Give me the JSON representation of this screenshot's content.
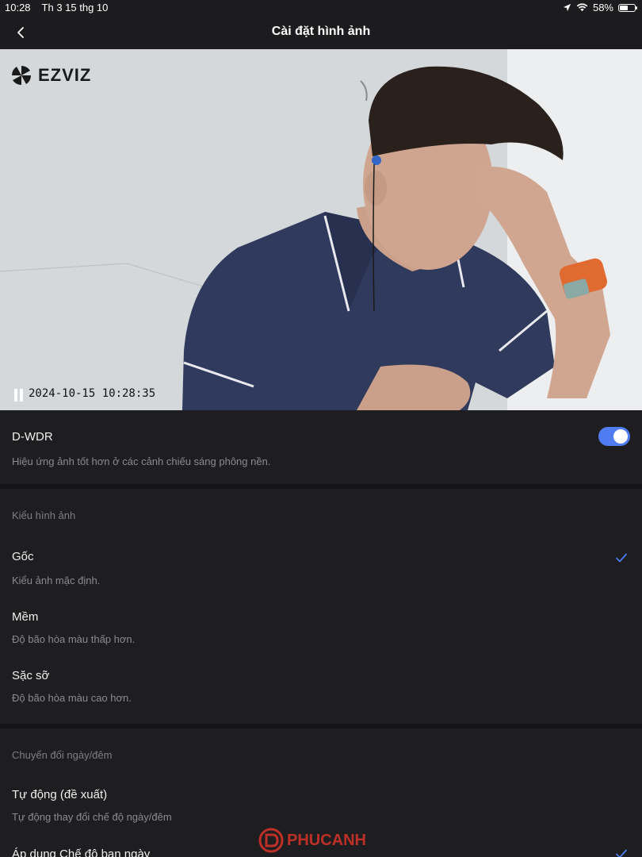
{
  "status_bar": {
    "time": "10:28",
    "date": "Th 3 15 thg 10",
    "battery": "58%",
    "battery_level": 0.58
  },
  "nav": {
    "title": "Cài đặt hình ảnh"
  },
  "video": {
    "brand": "EZVIZ",
    "timestamp": "2024-10-15 10:28:35"
  },
  "wdr": {
    "title": "D-WDR",
    "description": "Hiệu ứng ảnh tốt hơn ở các cảnh chiếu sáng phông nền.",
    "enabled": true
  },
  "image_style": {
    "header": "Kiểu hình ảnh",
    "options": [
      {
        "title": "Gốc",
        "description": "Kiểu ảnh mặc định.",
        "selected": true
      },
      {
        "title": "Mềm",
        "description": "Độ bão hòa màu thấp hơn.",
        "selected": false
      },
      {
        "title": "Sặc sỡ",
        "description": "Độ bão hòa màu cao hơn.",
        "selected": false
      }
    ]
  },
  "day_night": {
    "header": "Chuyển đổi ngày/đêm",
    "options": [
      {
        "title": "Tự động (đề xuất)",
        "description": "Tự động thay đổi chế độ ngày/đêm",
        "selected": false
      },
      {
        "title": "Áp dụng Chế độ ban ngày",
        "selected": true
      }
    ]
  },
  "watermark": {
    "text": "PHUCANH"
  },
  "colors": {
    "accent": "#4f7cf0",
    "background": "#1e1e20"
  }
}
